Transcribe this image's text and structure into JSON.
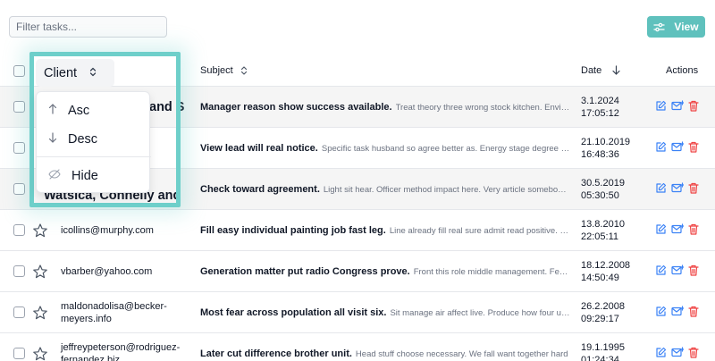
{
  "filter": {
    "placeholder": "Filter tasks..."
  },
  "view_button": {
    "label": "View",
    "icon": "sliders-icon",
    "color": "#5fc1bd"
  },
  "columns": {
    "client": "Client",
    "subject": "Subject",
    "date": "Date",
    "actions": "Actions"
  },
  "client_menu": {
    "items": [
      {
        "label": "Asc",
        "icon": "arrow-up-icon"
      },
      {
        "label": "Desc",
        "icon": "arrow-down-icon"
      },
      {
        "label": "Hide",
        "icon": "eye-off-icon"
      }
    ]
  },
  "rows": [
    {
      "client": "and S",
      "subject_title": "Manager reason show success available.",
      "subject_desc": "Treat theory three wrong stock kitchen. Environment",
      "date": "3.1.2024",
      "time": "17:05:12"
    },
    {
      "client": "",
      "subject_title": "View lead will real notice.",
      "subject_desc": "Specific task husband so agree better as. Energy stage degree kitchen",
      "date": "21.10.2019",
      "time": "16:48:36"
    },
    {
      "client": "Watsica, Connelly and",
      "subject_title": "Check toward agreement.",
      "subject_desc": "Light sit hear. Officer method impact here. Very article somebody north",
      "date": "30.5.2019",
      "time": "05:30:50"
    },
    {
      "client": "icollins@murphy.com",
      "subject_title": "Fill easy individual painting job fast leg.",
      "subject_desc": "Line already fill real sure admit read positive. Feel",
      "date": "13.8.2010",
      "time": "22:05:11"
    },
    {
      "client": "vbarber@yahoo.com",
      "subject_title": "Generation matter put radio Congress prove.",
      "subject_desc": "Front this role middle management. Feel person",
      "date": "18.12.2008",
      "time": "14:50:49"
    },
    {
      "client": "maldonadolisa@becker-meyers.info",
      "subject_title": "Most fear across population all visit six.",
      "subject_desc": "Sit manage air affect live. Produce how four up sea",
      "date": "26.2.2008",
      "time": "09:29:17"
    },
    {
      "client": "jeffreypeterson@rodriguez-fernandez.biz",
      "subject_title": "Later cut difference brother unit.",
      "subject_desc": "Head stuff choose necessary. We fall want together hard",
      "date": "19.1.1995",
      "time": "01:24:34"
    }
  ],
  "colors": {
    "accent": "#5fc1bd",
    "edit": "#3b82f6",
    "delete": "#ef4444",
    "highlight": "#6ecfca"
  }
}
